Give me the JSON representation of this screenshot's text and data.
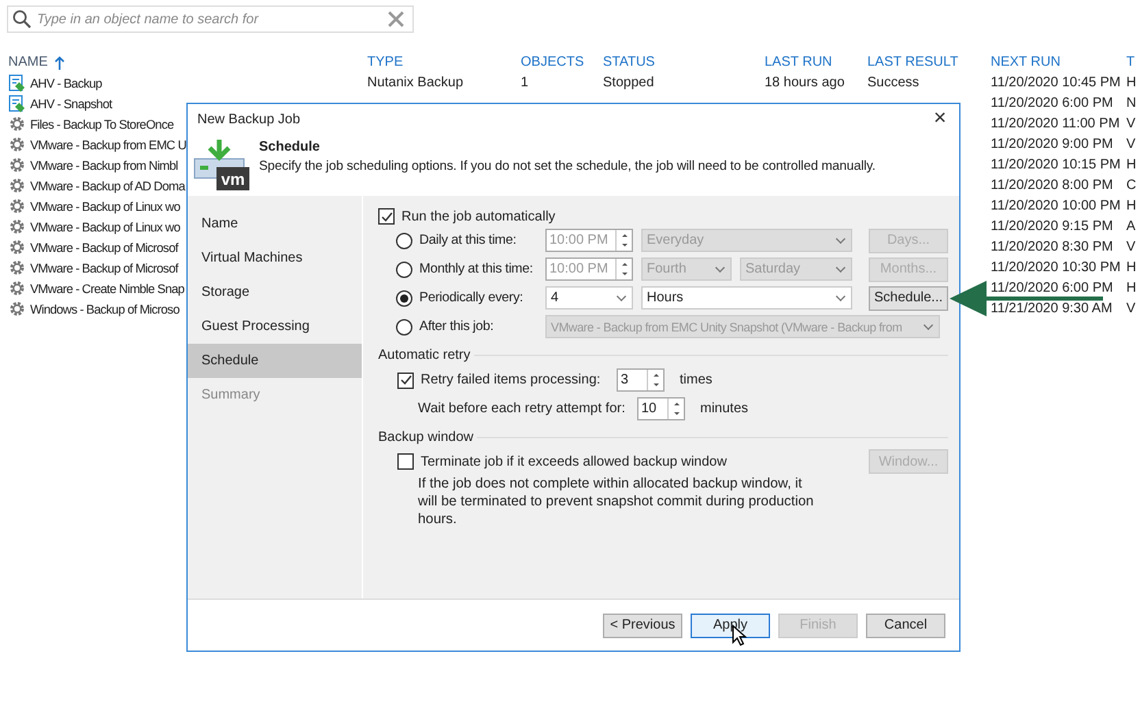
{
  "search": {
    "placeholder": "Type in an object name to search for"
  },
  "columns": [
    {
      "label": "NAME",
      "sorted": true
    },
    {
      "label": "TYPE",
      "sorted": false
    },
    {
      "label": "OBJECTS",
      "sorted": false
    },
    {
      "label": "STATUS",
      "sorted": false
    },
    {
      "label": "LAST RUN",
      "sorted": false
    },
    {
      "label": "LAST RESULT",
      "sorted": false
    },
    {
      "label": "NEXT RUN",
      "sorted": false
    },
    {
      "label": "T",
      "sorted": false
    }
  ],
  "rows": [
    {
      "kind": "agent",
      "name": "AHV - Backup",
      "type": "Nutanix Backup",
      "objects": "1",
      "status": "Stopped",
      "last_run": "18 hours ago",
      "last_result": "Success",
      "next_run": "11/20/2020 10:45 PM",
      "column_8": "H"
    },
    {
      "kind": "agent",
      "name": "AHV - Snapshot",
      "next_run": "11/20/2020 6:00 PM",
      "column_8": "N"
    },
    {
      "kind": "job",
      "name": "Files - Backup To StoreOnce",
      "next_run": "11/20/2020 11:00 PM",
      "column_8": "V"
    },
    {
      "kind": "job",
      "name": "VMware - Backup from EMC U",
      "next_run": "11/20/2020 9:00 PM",
      "column_8": "V"
    },
    {
      "kind": "job",
      "name": "VMware - Backup from Nimbl",
      "next_run": "11/20/2020 10:15 PM",
      "column_8": "H"
    },
    {
      "kind": "job",
      "name": "VMware - Backup of AD Doma",
      "next_run": "11/20/2020 8:00 PM",
      "column_8": "C"
    },
    {
      "kind": "job",
      "name": "VMware - Backup of Linux wo",
      "next_run": "11/20/2020 10:00 PM",
      "column_8": "H"
    },
    {
      "kind": "job",
      "name": "VMware - Backup of Linux wo",
      "next_run": "11/20/2020 9:15 PM",
      "column_8": "A"
    },
    {
      "kind": "job",
      "name": "VMware - Backup of Microsof",
      "next_run": "11/20/2020 8:30 PM",
      "column_8": "V"
    },
    {
      "kind": "job",
      "name": "VMware - Backup of Microsof",
      "next_run": "11/20/2020 10:30 PM",
      "column_8": "H"
    },
    {
      "kind": "job",
      "name": "VMware - Create Nimble Snap",
      "next_run": "11/20/2020 6:00 PM",
      "column_8": "H"
    },
    {
      "kind": "job",
      "name": "Windows - Backup of Microso",
      "next_run": "11/21/2020 9:30 AM",
      "column_8": "V"
    }
  ],
  "dialog": {
    "title": "New Backup Job",
    "close": "×",
    "header": {
      "icon_label": "vm",
      "title": "Schedule",
      "description": "Specify the job scheduling options. If you do not set the schedule, the job will need to be controlled manually."
    },
    "nav": [
      {
        "label": "Name",
        "selected": false,
        "disabled": false
      },
      {
        "label": "Virtual Machines",
        "selected": false,
        "disabled": false
      },
      {
        "label": "Storage",
        "selected": false,
        "disabled": false
      },
      {
        "label": "Guest Processing",
        "selected": false,
        "disabled": false
      },
      {
        "label": "Schedule",
        "selected": true,
        "disabled": false
      },
      {
        "label": "Summary",
        "selected": false,
        "disabled": true
      }
    ],
    "run_automatically": {
      "label": "Run the job automatically",
      "checked": true
    },
    "options": [
      {
        "kind": "daily",
        "label": "Daily at this time:",
        "selected": false,
        "time": "10:00 PM",
        "days": "Everyday",
        "button": "Days..."
      },
      {
        "kind": "monthly",
        "label": "Monthly at this time:",
        "selected": false,
        "time": "10:00 PM",
        "week": "Fourth",
        "day": "Saturday",
        "button": "Months..."
      },
      {
        "kind": "periodic",
        "label": "Periodically every:",
        "selected": true,
        "value": "4",
        "unit": "Hours",
        "button": "Schedule..."
      },
      {
        "kind": "after",
        "label": "After this job:",
        "selected": false,
        "job": "VMware - Backup from EMC Unity Snapshot (VMware - Backup from"
      }
    ],
    "retry": {
      "title": "Automatic retry",
      "retry_label": "Retry failed items processing:",
      "checked": true,
      "count": "3",
      "count_unit": "times",
      "wait_label": "Wait before each retry attempt for:",
      "wait": "10",
      "wait_unit": "minutes"
    },
    "backup_window": {
      "title": "Backup window",
      "label": "Terminate job if it exceeds allowed backup window",
      "checked": false,
      "note": "If the job does not complete within allocated backup window, it will be terminated to prevent snapshot commit during production hours.",
      "button": "Window..."
    },
    "buttons": [
      {
        "label": "< Previous",
        "disabled": false,
        "focused": false
      },
      {
        "label": "Apply",
        "disabled": false,
        "focused": true
      },
      {
        "label": "Finish",
        "disabled": true,
        "focused": false
      },
      {
        "label": "Cancel",
        "disabled": false,
        "focused": false
      }
    ]
  }
}
